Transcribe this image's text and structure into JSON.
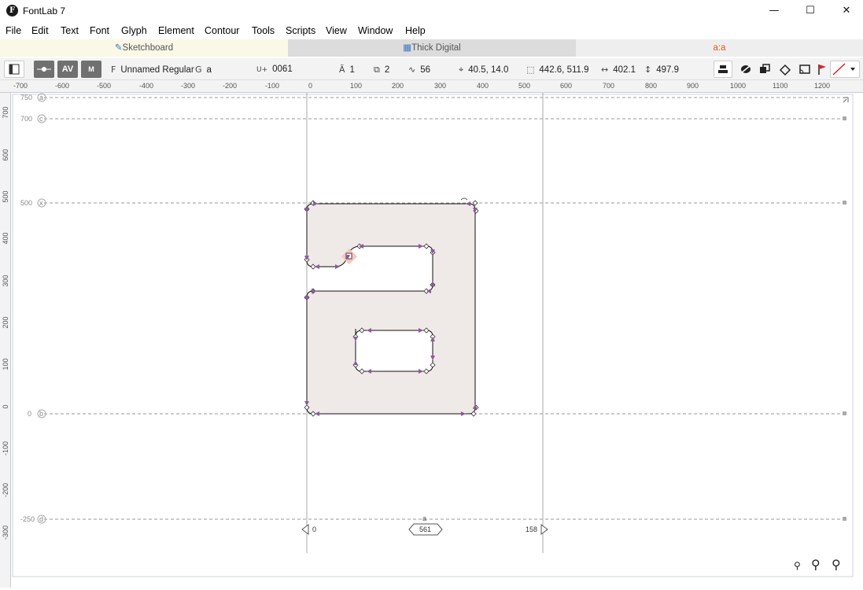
{
  "window": {
    "title": "FontLab 7",
    "app_icon_letter": "F",
    "minimize": "—",
    "maximize": "☐",
    "close": "✕"
  },
  "menu": [
    "File",
    "Edit",
    "Text",
    "Font",
    "Glyph",
    "Element",
    "Contour",
    "Tools",
    "Scripts",
    "View",
    "Window",
    "Help"
  ],
  "tabs": [
    {
      "label": "Sketchboard",
      "icon": "pen-icon",
      "active": true
    },
    {
      "label": "Thick Digital",
      "icon": "grid-icon",
      "active": false
    },
    {
      "label": "a:a",
      "icon": "",
      "active": false
    }
  ],
  "toolbar": {
    "font_prefix": "F",
    "font_name": "Unnamed Regular",
    "glyph_prefix": "G",
    "glyph_name": "a",
    "unicode_prefix": "U+",
    "unicode": "0061",
    "layers_count": "1",
    "contours_count": "2",
    "nodes_count": "56",
    "coords": "40.5, 14.0",
    "selection_size": "442.6, 511.9",
    "advance_width": "402.1",
    "height": "497.9",
    "kerning_label": "AV",
    "metrics_label": "M"
  },
  "ruler_top": [
    "-700",
    "-600",
    "-500",
    "-400",
    "-300",
    "-200",
    "-100",
    "0",
    "100",
    "200",
    "300",
    "400",
    "500",
    "600",
    "700",
    "800",
    "900",
    "1000",
    "1100",
    "1200"
  ],
  "ruler_left": [
    "700",
    "600",
    "500",
    "400",
    "300",
    "200",
    "100",
    "0",
    "-100",
    "-200",
    "-300"
  ],
  "guides": {
    "ascender": {
      "value": "750",
      "tag": "a"
    },
    "cap": {
      "value": "700",
      "tag": "c"
    },
    "xheight": {
      "value": "500",
      "tag": "x"
    },
    "baseline": {
      "value": "0",
      "tag": "b"
    },
    "descender": {
      "value": "-250",
      "tag": "d"
    }
  },
  "glyph": {
    "name": "a",
    "lsb": "0",
    "advance": "561",
    "rsb": "158"
  },
  "colors": {
    "glyph_fill": "#efe9e7",
    "node_arrow": "#8d5a9a",
    "guide": "#9a9a9a",
    "tab_active_bg": "#fbf8e6",
    "tab_inactive_bg": "#dcdcdc",
    "tab_right_bg": "#eeeeee",
    "accent_red": "#e02020"
  }
}
